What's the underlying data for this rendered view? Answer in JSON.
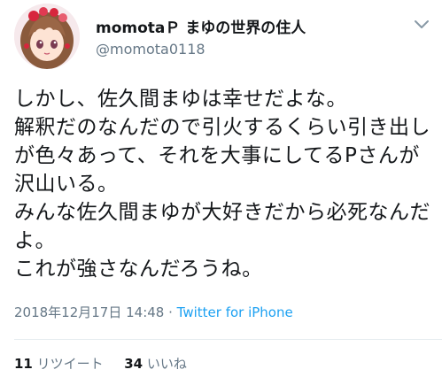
{
  "user": {
    "display_name": "momotaＰ まゆの世界の住人",
    "handle": "@momota0118",
    "avatar_icon": "avatar-anime-girl"
  },
  "tweet": {
    "text": "しかし、佐久間まゆは幸せだよな。\n解釈だのなんだので引火するくらい引き出しが色々あって、それを大事にしてるPさんが沢山いる。\nみんな佐久間まゆが大好きだから必死なんだよ。\nこれが強さなんだろうね。",
    "timestamp": "2018年12月17日 14:48",
    "separator": " · ",
    "source": "Twitter for iPhone"
  },
  "stats": {
    "retweets_count": "11",
    "retweets_label": "リツイート",
    "likes_count": "34",
    "likes_label": "いいね"
  },
  "colors": {
    "text": "#14171a",
    "secondary": "#657786",
    "link": "#1da1f2",
    "divider": "#e6ecf0"
  }
}
